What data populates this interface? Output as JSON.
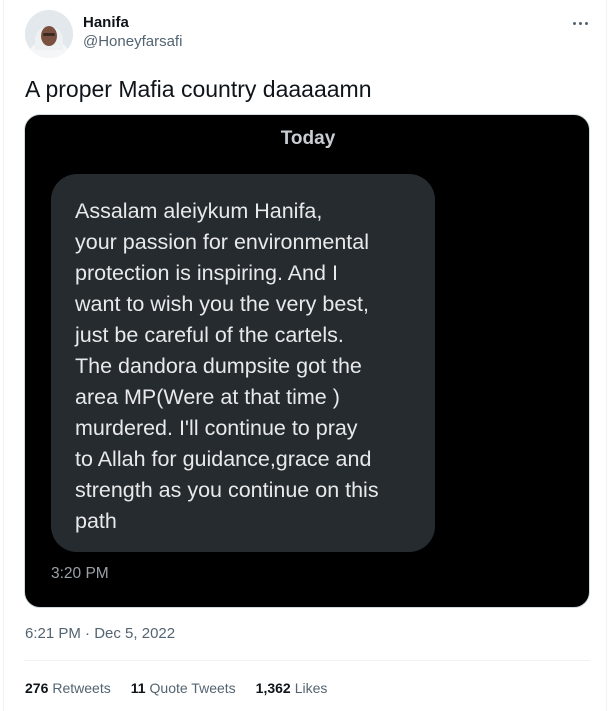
{
  "author": {
    "display_name": "Hanifa",
    "handle": "@Honeyfarsafi"
  },
  "tweet": {
    "text": "A proper Mafia country daaaaamn"
  },
  "media": {
    "day_label": "Today",
    "message": "Assalam aleiykum Hanifa,\nyour passion for environmental\nprotection is inspiring. And I\nwant to wish you the very best,\njust be careful of the cartels.\nThe dandora dumpsite got the\narea MP(Were at that time )\nmurdered. I'll continue to pray\nto Allah for guidance,grace and\nstrength as you continue on this\npath",
    "message_time": "3:20 PM"
  },
  "meta": {
    "time": "6:21 PM",
    "separator": "·",
    "date": "Dec 5, 2022"
  },
  "stats": {
    "retweets_count": "276",
    "retweets_label": "Retweets",
    "quotes_count": "11",
    "quotes_label": "Quote Tweets",
    "likes_count": "1,362",
    "likes_label": "Likes"
  },
  "colors": {
    "text_primary": "#0f1419",
    "text_secondary": "#536471",
    "media_background": "#000000",
    "bubble": "#262b30"
  }
}
